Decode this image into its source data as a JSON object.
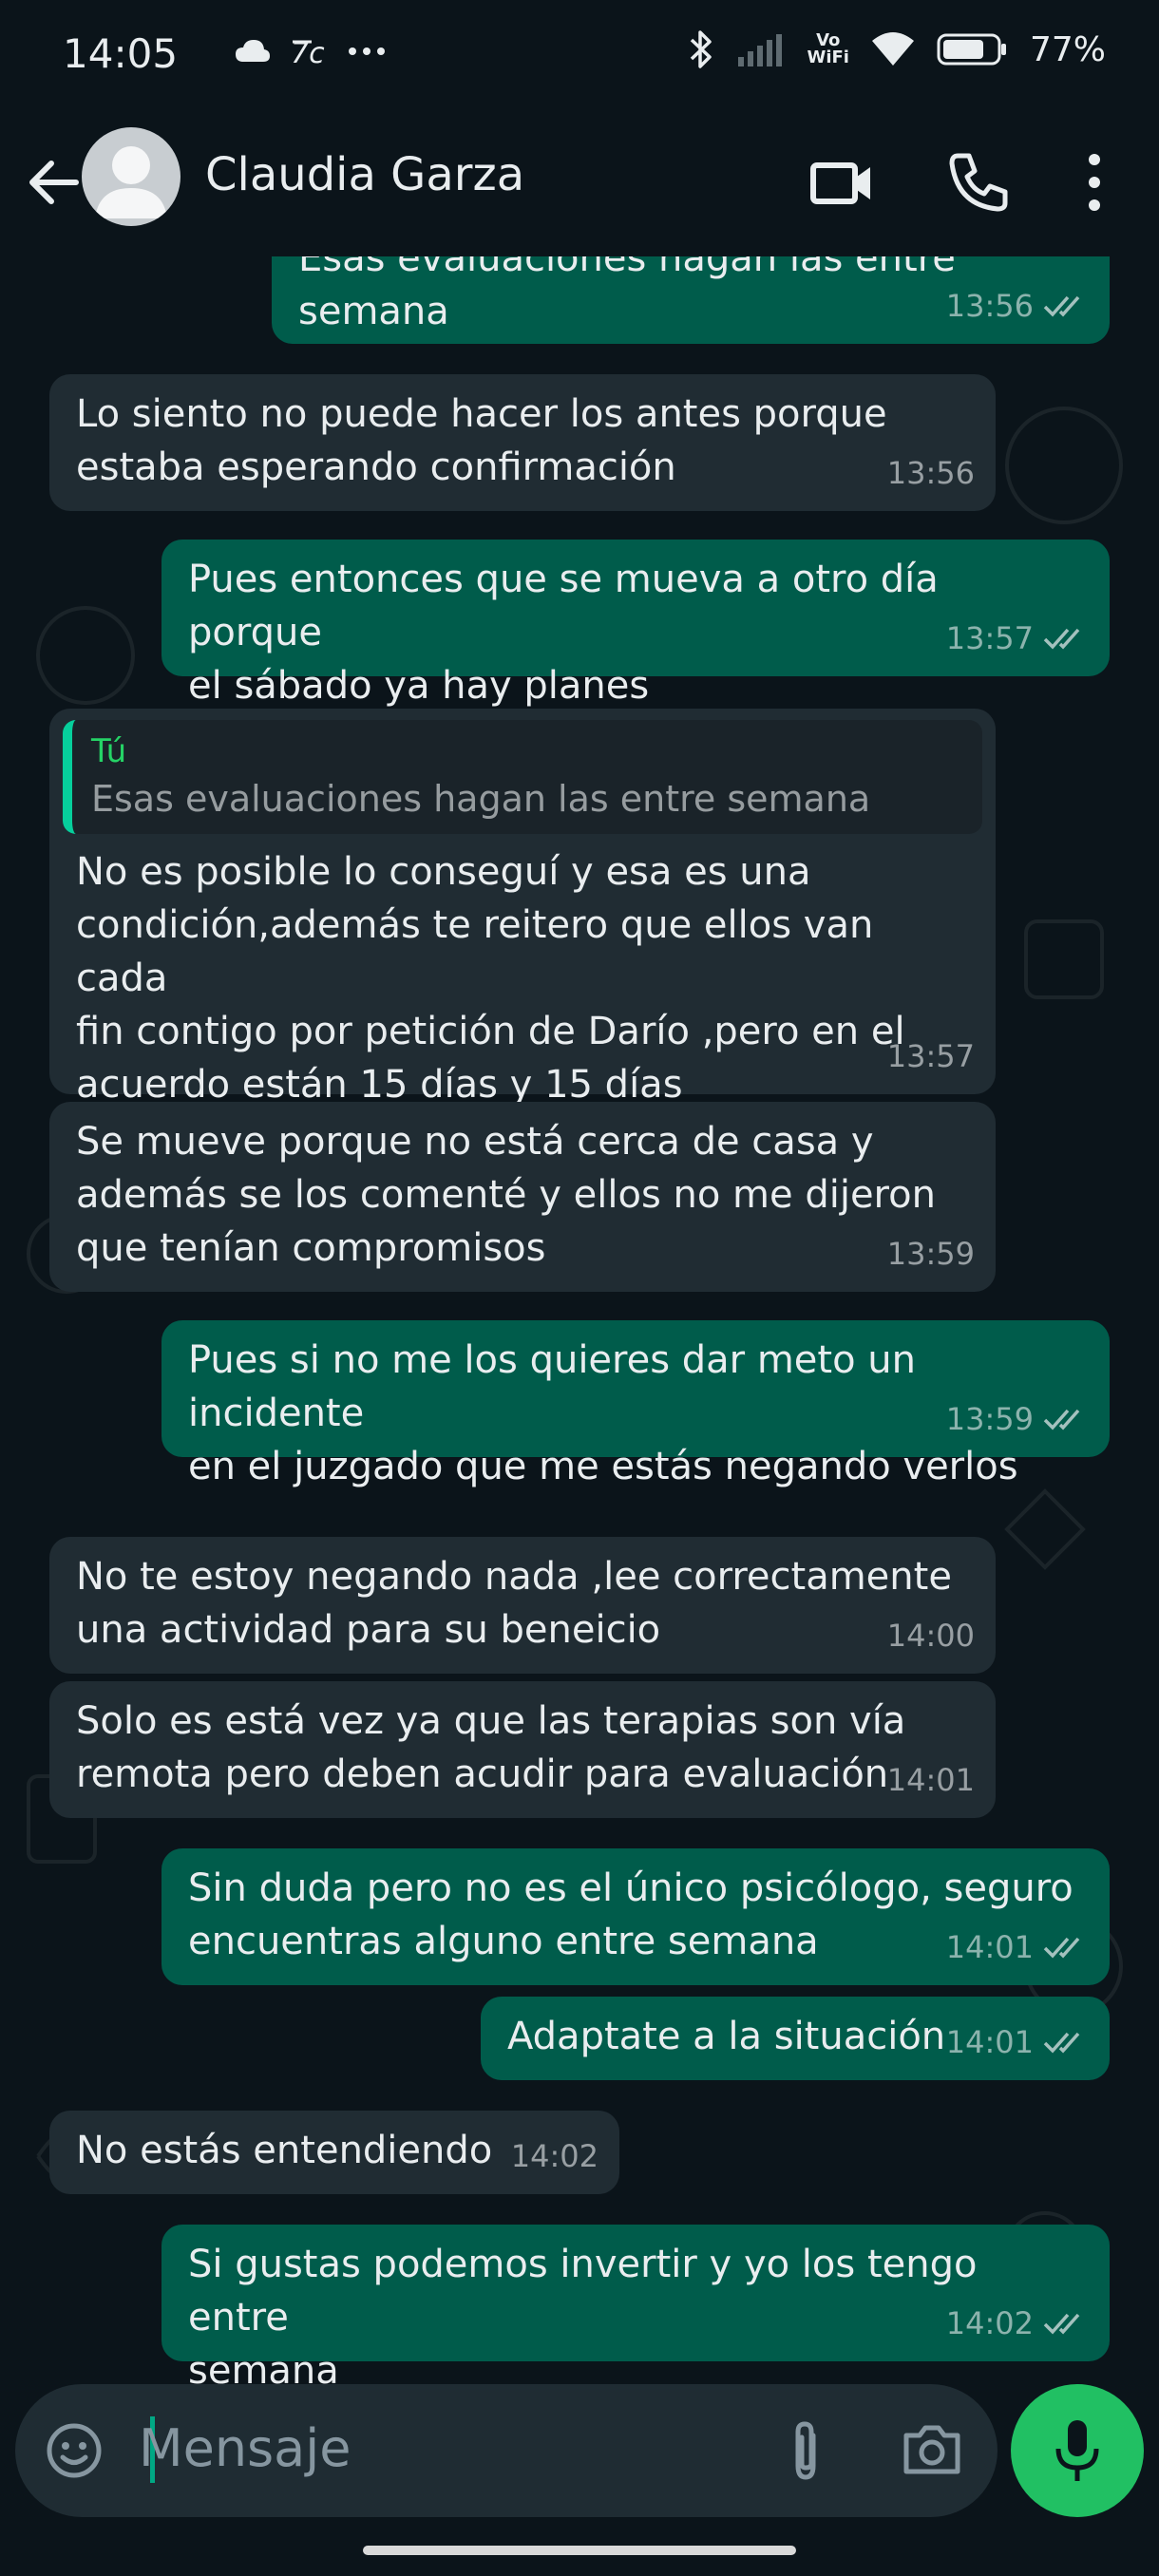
{
  "status_bar": {
    "time": "14:05",
    "battery": "77%",
    "vowifi_top": "Vo",
    "vowifi_bottom": "WiFi",
    "icons": [
      "cloud-icon",
      "tm-icon",
      "more-dots-icon",
      "bluetooth-icon",
      "signal-icon",
      "wifi-icon",
      "battery-icon"
    ]
  },
  "header": {
    "contact_name": "Claudia Garza",
    "icons": [
      "back-arrow-icon",
      "avatar",
      "video-call-icon",
      "voice-call-icon",
      "more-vert-icon"
    ]
  },
  "messages": [
    {
      "dir": "out",
      "text": "Esas evaluaciones hagan las entre semana",
      "time": "13:56",
      "ticks": true
    },
    {
      "dir": "in",
      "text": "Lo siento no puede hacer los antes porque\nestaba esperando confirmación",
      "time": "13:56"
    },
    {
      "dir": "out",
      "text": "Pues entonces que se mueva a otro día porque\nel sábado ya hay planes",
      "time": "13:57",
      "ticks": true
    },
    {
      "dir": "in",
      "quote_author": "Tú",
      "quote_text": "Esas evaluaciones hagan las entre semana",
      "text": "No es posible lo conseguí y esa es una\ncondición,además te reitero que ellos van cada\nfin contigo por petición de Darío ,pero en el\nacuerdo están 15 días y 15 días",
      "time": "13:57"
    },
    {
      "dir": "in",
      "text": "Se mueve porque no está cerca de casa y\nademás se los comenté y ellos no me dijeron\nque tenían compromisos",
      "time": "13:59"
    },
    {
      "dir": "out",
      "text": "Pues si no me los quieres dar meto un incidente\nen el juzgado que me estás negando verlos",
      "time": "13:59",
      "ticks": true
    },
    {
      "dir": "in",
      "text": "No te estoy negando nada ,lee correctamente\nuna actividad para su beneicio",
      "time": "14:00"
    },
    {
      "dir": "in",
      "text": "Solo es está vez ya que las terapias son vía\nremota pero deben acudir para evaluación",
      "time": "14:01"
    },
    {
      "dir": "out",
      "text": "Sin duda pero no es el único psicólogo, seguro\nencuentras alguno entre semana",
      "time": "14:01",
      "ticks": true
    },
    {
      "dir": "out",
      "text": "Adaptate a la situación",
      "time": "14:01",
      "ticks": true
    },
    {
      "dir": "in",
      "text": "No estás entendiendo",
      "time": "14:02"
    },
    {
      "dir": "out",
      "text": "Si gustas podemos invertir y yo los tengo entre\nsemana",
      "time": "14:02",
      "ticks": true
    }
  ],
  "input": {
    "placeholder": "Mensaje",
    "icons": [
      "emoji-icon",
      "attach-icon",
      "camera-icon",
      "mic-icon"
    ]
  },
  "colors": {
    "background": "#0b141a",
    "incoming_bubble": "#202c33",
    "outgoing_bubble": "#005c4b",
    "accent": "#21c063",
    "read_ticks": "#e9edef"
  }
}
